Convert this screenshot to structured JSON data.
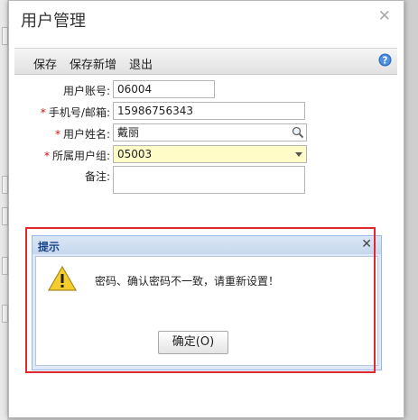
{
  "dialog": {
    "title": "用户管理",
    "close_icon": "close-icon"
  },
  "toolbar": {
    "save_label": "保存",
    "save_new_label": "保存新增",
    "exit_label": "退出",
    "help_icon": "help-icon"
  },
  "form": {
    "account": {
      "label": "用户账号:",
      "value": "06004",
      "required": false
    },
    "phone_email": {
      "label": "手机号/邮箱:",
      "value": "15986756343",
      "required": true,
      "required_mark": "*"
    },
    "name": {
      "label": "用户姓名:",
      "value": "戴丽",
      "required": true,
      "required_mark": "*"
    },
    "group": {
      "label": "所属用户组:",
      "value": "05003",
      "required": true,
      "required_mark": "*"
    },
    "remark": {
      "label": "备注:",
      "value": ""
    }
  },
  "message_box": {
    "title": "提示",
    "message": "密码、确认密码不一致，请重新设置！",
    "ok_label": "确定(O)",
    "icon": "warning-icon"
  },
  "colors": {
    "highlight": "#e0282e",
    "required": "#d01010",
    "field_yellow": "#fffcc8",
    "msg_title": "#15428b"
  }
}
